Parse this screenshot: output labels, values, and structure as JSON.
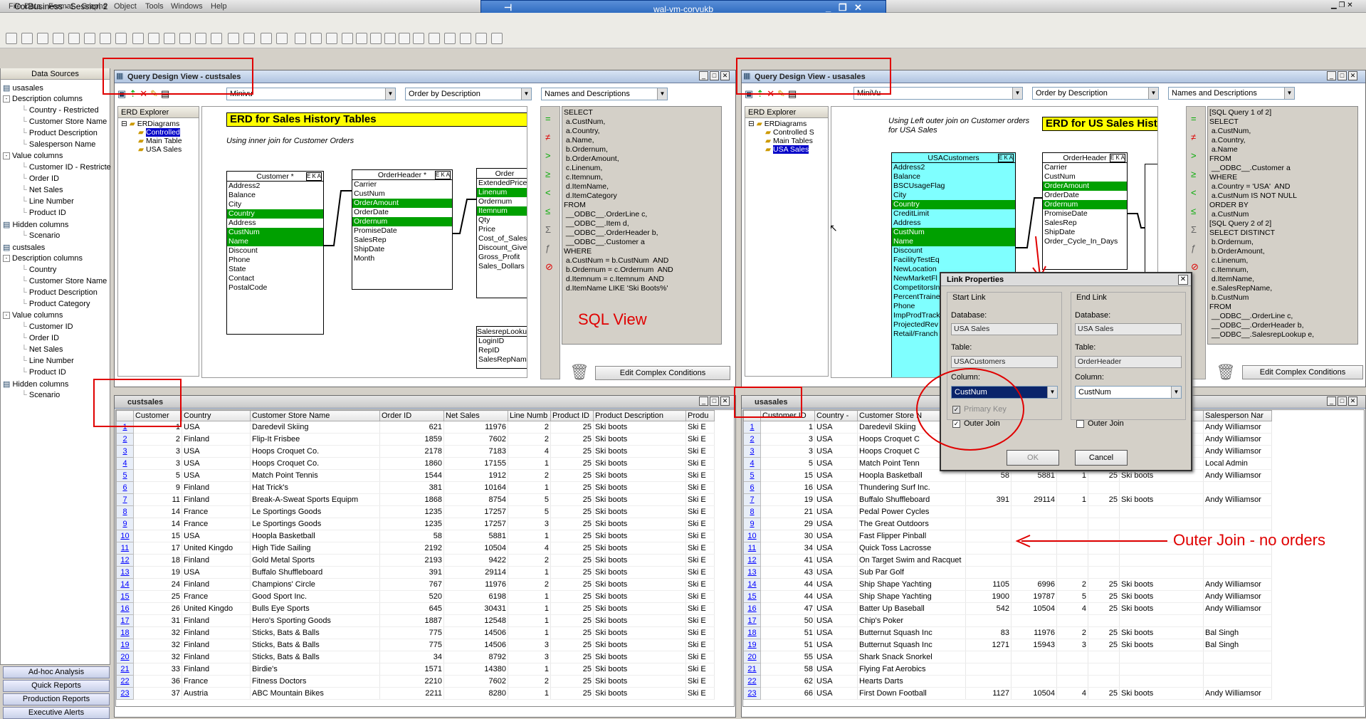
{
  "app": {
    "title": "CorBusiness - Session 2",
    "vm_title": "wal-vm-corvukb"
  },
  "menu": [
    "File",
    "Data",
    "Format",
    "Graphs",
    "Object",
    "Tools",
    "Windows",
    "Help"
  ],
  "datasources": {
    "header": "Data Sources"
  },
  "tree": [
    {
      "t": "usasales",
      "lv": 0
    },
    {
      "t": "Description columns",
      "lv": 0,
      "box": "-"
    },
    {
      "t": "Country - Restricted",
      "lv": 1
    },
    {
      "t": "Customer Store Name",
      "lv": 1
    },
    {
      "t": "Product Description",
      "lv": 1
    },
    {
      "t": "Salesperson Name",
      "lv": 1
    },
    {
      "t": "Value columns",
      "lv": 0,
      "box": "-"
    },
    {
      "t": "Customer ID - Restricte",
      "lv": 1
    },
    {
      "t": "Order ID",
      "lv": 1
    },
    {
      "t": "Net Sales",
      "lv": 1
    },
    {
      "t": "Line Number",
      "lv": 1
    },
    {
      "t": "Product ID",
      "lv": 1
    },
    {
      "t": "Hidden columns",
      "lv": 0
    },
    {
      "t": "Scenario",
      "lv": 1
    },
    {
      "t": "custsales",
      "lv": 0
    },
    {
      "t": "Description columns",
      "lv": 0,
      "box": "-"
    },
    {
      "t": "Country",
      "lv": 1
    },
    {
      "t": "Customer Store Name",
      "lv": 1
    },
    {
      "t": "Product Description",
      "lv": 1
    },
    {
      "t": "Product Category",
      "lv": 1
    },
    {
      "t": "Value columns",
      "lv": 0,
      "box": "-"
    },
    {
      "t": "Customer ID",
      "lv": 1
    },
    {
      "t": "Order ID",
      "lv": 1
    },
    {
      "t": "Net Sales",
      "lv": 1
    },
    {
      "t": "Line Number",
      "lv": 1
    },
    {
      "t": "Product ID",
      "lv": 1
    },
    {
      "t": "Hidden columns",
      "lv": 0
    },
    {
      "t": "Scenario",
      "lv": 1
    }
  ],
  "left_buttons": [
    "Ad-hoc Analysis",
    "Quick Reports",
    "Production Reports",
    "Executive Alerts"
  ],
  "qd1": {
    "title": "Query Design View - custsales",
    "combo1": "Minivu",
    "combo2": "Order by Description",
    "combo3": "Names and Descriptions",
    "explorer": "ERD Explorer",
    "erd_root": "ERDiagrams",
    "erd_items": [
      "Controlled",
      "Main Table",
      "USA Sales"
    ],
    "erd_title": "ERD for Sales History Tables",
    "note": "Using inner join for Customer Orders",
    "customer_hdr": "Customer *",
    "customer": [
      "Address2",
      "Balance",
      "City",
      "Country",
      "Address",
      "CustNum",
      "Name",
      "Discount",
      "Phone",
      "State",
      "Contact",
      "PostalCode"
    ],
    "orderheader_hdr": "OrderHeader *",
    "orderheader": [
      "Carrier",
      "CustNum",
      "OrderAmount",
      "OrderDate",
      "Ordernum",
      "PromiseDate",
      "SalesRep",
      "ShipDate",
      "Month"
    ],
    "order_hdr": "Order",
    "order": [
      "ExtendedPrice",
      "Linenum",
      "Ordernum",
      "Itemnum",
      "Qty",
      "Price",
      "Cost_of_Sales",
      "Discount_Give",
      "Gross_Profit",
      "Sales_Dollars"
    ],
    "salesrep_hdr": "SalesrepLookup",
    "salesrep": [
      "LoginID",
      "RepID",
      "SalesRepNam"
    ],
    "sql": "SELECT\n a.CustNum,\n a.Country,\n a.Name,\n b.Ordernum,\n b.OrderAmount,\n c.Linenum,\n c.Itemnum,\n d.ItemName,\n d.ItemCategory\nFROM\n __ODBC__.OrderLine c,\n __ODBC__.Item d,\n __ODBC__.OrderHeader b,\n __ODBC__.Customer a\nWHERE\n a.CustNum = b.CustNum  AND\n b.Ordernum = c.Ordernum  AND\n d.Itemnum = c.Itemnum  AND\n d.ItemName LIKE 'Ski Boots%'",
    "sql_label": "SQL View",
    "edit_btn": "Edit Complex Conditions"
  },
  "qd2": {
    "title": "Query Design View - usasales",
    "combo1": "MiniVu",
    "combo2": "Order by Description",
    "combo3": "Names and Descriptions",
    "explorer": "ERD Explorer",
    "erd_root": "ERDiagrams",
    "erd_items": [
      "Controlled S",
      "Main Tables",
      "USA Sales"
    ],
    "erd_title": "ERD for US Sales Hist",
    "note": "Using Left outer join on Customer orders\nfor USA Sales",
    "cust_hdr": "USACustomers",
    "cust": [
      "Address2",
      "Balance",
      "BSCUsageFlag",
      "City",
      "Country",
      "CreditLimit",
      "Address",
      "CustNum",
      "Name",
      "Discount",
      "FacilityTestEq",
      "NewLocation",
      "NewMarketFl",
      "CompetitorsIn",
      "PercentTraine",
      "Phone",
      "ImpProdTrack",
      "ProjectedRev",
      "Retail/Franch"
    ],
    "oh_hdr": "OrderHeader",
    "oh": [
      "Carrier",
      "CustNum",
      "OrderAmount",
      "OrderDate",
      "Ordernum",
      "PromiseDate",
      "SalesRep",
      "ShipDate",
      "Order_Cycle_In_Days"
    ],
    "sql": "[SQL Query 1 of 2]\nSELECT\n a.CustNum,\n a.Country,\n a.Name\nFROM\n __ODBC__.Customer a\nWHERE\n a.Country = 'USA'  AND\n a.CustNum IS NOT NULL\nORDER BY\n a.CustNum\n[SQL Query 2 of 2]\nSELECT DISTINCT\n b.Ordernum,\n b.OrderAmount,\n c.Linenum,\n c.Itemnum,\n d.ItemName,\n e.SalesRepName,\n b.CustNum\nFROM\n __ODBC__.OrderLine c,\n __ODBC__.OrderHeader b,\n __ODBC__.SalesrepLookup e,",
    "edit_btn": "Edit Complex Conditions"
  },
  "dialog": {
    "title": "Link Properties",
    "start": "Start Link",
    "end": "End Link",
    "db_label": "Database:",
    "db_start": "USA Sales",
    "db_end": "USA Sales",
    "table_label": "Table:",
    "table_start": "USACustomers",
    "table_end": "OrderHeader",
    "col_label": "Column:",
    "col_start": "CustNum",
    "col_end": "CustNum",
    "pk": "Primary Key",
    "outer": "Outer Join",
    "ok": "OK",
    "cancel": "Cancel"
  },
  "annotation": "Outer Join - no orders",
  "grid1": {
    "title": "custsales",
    "cols": [
      "Customer",
      "Country",
      "Customer Store Name",
      "Order ID",
      "Net Sales",
      "Line Numb",
      "Product ID",
      "Product Description",
      "Produ"
    ],
    "rows": [
      [
        "1",
        "1",
        "USA",
        "Daredevil Skiing",
        "621",
        "11976",
        "2",
        "25",
        "Ski boots",
        "Ski E"
      ],
      [
        "2",
        "2",
        "Finland",
        "Flip-It Frisbee",
        "1859",
        "7602",
        "2",
        "25",
        "Ski boots",
        "Ski E"
      ],
      [
        "3",
        "3",
        "USA",
        "Hoops Croquet Co.",
        "2178",
        "7183",
        "4",
        "25",
        "Ski boots",
        "Ski E"
      ],
      [
        "4",
        "3",
        "USA",
        "Hoops Croquet Co.",
        "1860",
        "17155",
        "1",
        "25",
        "Ski boots",
        "Ski E"
      ],
      [
        "5",
        "5",
        "USA",
        "Match Point Tennis",
        "1544",
        "1912",
        "2",
        "25",
        "Ski boots",
        "Ski E"
      ],
      [
        "6",
        "9",
        "Finland",
        "Hat Trick's",
        "381",
        "10164",
        "1",
        "25",
        "Ski boots",
        "Ski E"
      ],
      [
        "7",
        "11",
        "Finland",
        "Break-A-Sweat Sports Equipm",
        "1868",
        "8754",
        "5",
        "25",
        "Ski boots",
        "Ski E"
      ],
      [
        "8",
        "14",
        "France",
        "Le Sportings Goods",
        "1235",
        "17257",
        "5",
        "25",
        "Ski boots",
        "Ski E"
      ],
      [
        "9",
        "14",
        "France",
        "Le Sportings Goods",
        "1235",
        "17257",
        "3",
        "25",
        "Ski boots",
        "Ski E"
      ],
      [
        "10",
        "15",
        "USA",
        "Hoopla Basketball",
        "58",
        "5881",
        "1",
        "25",
        "Ski boots",
        "Ski E"
      ],
      [
        "11",
        "17",
        "United Kingdo",
        "High Tide Sailing",
        "2192",
        "10504",
        "4",
        "25",
        "Ski boots",
        "Ski E"
      ],
      [
        "12",
        "18",
        "Finland",
        "Gold Metal Sports",
        "2193",
        "9422",
        "2",
        "25",
        "Ski boots",
        "Ski E"
      ],
      [
        "13",
        "19",
        "USA",
        "Buffalo Shuffleboard",
        "391",
        "29114",
        "1",
        "25",
        "Ski boots",
        "Ski E"
      ],
      [
        "14",
        "24",
        "Finland",
        "Champions' Circle",
        "767",
        "11976",
        "2",
        "25",
        "Ski boots",
        "Ski E"
      ],
      [
        "15",
        "25",
        "France",
        "Good Sport Inc.",
        "520",
        "6198",
        "1",
        "25",
        "Ski boots",
        "Ski E"
      ],
      [
        "16",
        "26",
        "United Kingdo",
        "Bulls Eye Sports",
        "645",
        "30431",
        "1",
        "25",
        "Ski boots",
        "Ski E"
      ],
      [
        "17",
        "31",
        "Finland",
        "Hero's Sporting Goods",
        "1887",
        "12548",
        "1",
        "25",
        "Ski boots",
        "Ski E"
      ],
      [
        "18",
        "32",
        "Finland",
        "Sticks, Bats & Balls",
        "775",
        "14506",
        "1",
        "25",
        "Ski boots",
        "Ski E"
      ],
      [
        "19",
        "32",
        "Finland",
        "Sticks, Bats & Balls",
        "775",
        "14506",
        "3",
        "25",
        "Ski boots",
        "Ski E"
      ],
      [
        "20",
        "32",
        "Finland",
        "Sticks, Bats & Balls",
        "34",
        "8792",
        "3",
        "25",
        "Ski boots",
        "Ski E"
      ],
      [
        "21",
        "33",
        "Finland",
        "Birdie's",
        "1571",
        "14380",
        "1",
        "25",
        "Ski boots",
        "Ski E"
      ],
      [
        "22",
        "36",
        "France",
        "Fitness Doctors",
        "2210",
        "7602",
        "2",
        "25",
        "Ski boots",
        "Ski E"
      ],
      [
        "23",
        "37",
        "Austria",
        "ABC Mountain Bikes",
        "2211",
        "8280",
        "1",
        "25",
        "Ski boots",
        "Ski E"
      ]
    ]
  },
  "grid2": {
    "title": "usasales",
    "cols": [
      "Customer ID",
      "Country -",
      "Customer Store N",
      "",
      "",
      "",
      "D",
      "Product Descriptio",
      "Salesperson Nar"
    ],
    "rows": [
      [
        "1",
        "1",
        "USA",
        "Daredevil Skiing",
        "",
        "",
        "",
        "25",
        "Ski boots",
        "Andy Williamsor"
      ],
      [
        "2",
        "3",
        "USA",
        "Hoops Croquet C",
        "",
        "",
        "",
        "25",
        "Ski boots",
        "Andy Williamsor"
      ],
      [
        "3",
        "3",
        "USA",
        "Hoops Croquet C",
        "",
        "",
        "",
        "25",
        "Ski boots",
        "Andy Williamsor"
      ],
      [
        "4",
        "5",
        "USA",
        "Match Point Tenn",
        "",
        "",
        "",
        "25",
        "Ski boots",
        "Local Admin"
      ],
      [
        "5",
        "15",
        "USA",
        "Hoopla Basketball",
        "58",
        "5881",
        "1",
        "25",
        "Ski boots",
        "Andy Williamsor"
      ],
      [
        "6",
        "16",
        "USA",
        "Thundering Surf Inc.",
        "",
        "",
        "",
        "",
        "",
        ""
      ],
      [
        "7",
        "19",
        "USA",
        "Buffalo Shuffleboard",
        "391",
        "29114",
        "1",
        "25",
        "Ski boots",
        "Andy Williamsor"
      ],
      [
        "8",
        "21",
        "USA",
        "Pedal Power Cycles",
        "",
        "",
        "",
        "",
        "",
        ""
      ],
      [
        "9",
        "29",
        "USA",
        "The Great Outdoors",
        "",
        "",
        "",
        "",
        "",
        ""
      ],
      [
        "10",
        "30",
        "USA",
        "Fast Flipper Pinball",
        "",
        "",
        "",
        "",
        "",
        ""
      ],
      [
        "11",
        "34",
        "USA",
        "Quick Toss Lacrosse",
        "",
        "",
        "",
        "",
        "",
        ""
      ],
      [
        "12",
        "41",
        "USA",
        "On Target Swim and Racquet",
        "",
        "",
        "",
        "",
        "",
        ""
      ],
      [
        "13",
        "43",
        "USA",
        "Sub Par Golf",
        "",
        "",
        "",
        "",
        "",
        ""
      ],
      [
        "14",
        "44",
        "USA",
        "Ship Shape Yachting",
        "1105",
        "6996",
        "2",
        "25",
        "Ski boots",
        "Andy Williamsor"
      ],
      [
        "15",
        "44",
        "USA",
        "Ship Shape Yachting",
        "1900",
        "19787",
        "5",
        "25",
        "Ski boots",
        "Andy Williamsor"
      ],
      [
        "16",
        "47",
        "USA",
        "Batter Up Baseball",
        "542",
        "10504",
        "4",
        "25",
        "Ski boots",
        "Andy Williamsor"
      ],
      [
        "17",
        "50",
        "USA",
        "Chip's Poker",
        "",
        "",
        "",
        "",
        "",
        ""
      ],
      [
        "18",
        "51",
        "USA",
        "Butternut Squash Inc",
        "83",
        "11976",
        "2",
        "25",
        "Ski boots",
        "Bal Singh"
      ],
      [
        "19",
        "51",
        "USA",
        "Butternut Squash Inc",
        "1271",
        "15943",
        "3",
        "25",
        "Ski boots",
        "Bal Singh"
      ],
      [
        "20",
        "55",
        "USA",
        "Shark Snack Snorkel",
        "",
        "",
        "",
        "",
        "",
        ""
      ],
      [
        "21",
        "58",
        "USA",
        "Flying Fat Aerobics",
        "",
        "",
        "",
        "",
        "",
        ""
      ],
      [
        "22",
        "62",
        "USA",
        "Hearts Darts",
        "",
        "",
        "",
        "",
        "",
        ""
      ],
      [
        "23",
        "66",
        "USA",
        "First Down Football",
        "1127",
        "10504",
        "4",
        "25",
        "Ski boots",
        "Andy Williamsor"
      ]
    ]
  }
}
